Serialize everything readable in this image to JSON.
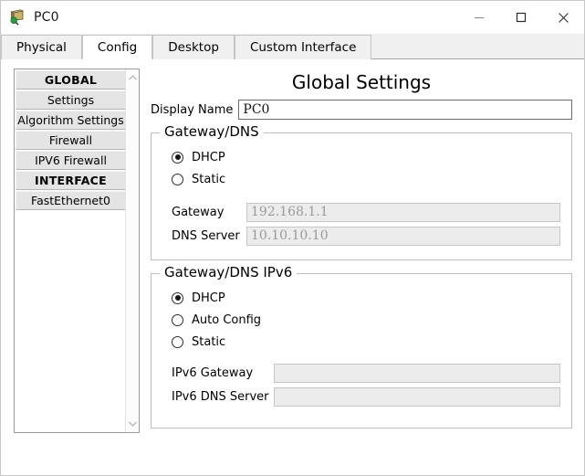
{
  "window": {
    "title": "PC0",
    "icon": "pc-device-icon",
    "controls": {
      "minimize": "minimize-icon",
      "maximize": "maximize-icon",
      "close": "close-icon"
    }
  },
  "tabs": [
    {
      "label": "Physical",
      "active": false
    },
    {
      "label": "Config",
      "active": true
    },
    {
      "label": "Desktop",
      "active": false
    },
    {
      "label": "Custom Interface",
      "active": false
    }
  ],
  "sidebar": {
    "items": [
      {
        "label": "GLOBAL",
        "type": "header"
      },
      {
        "label": "Settings",
        "type": "item"
      },
      {
        "label": "Algorithm Settings",
        "type": "item"
      },
      {
        "label": "Firewall",
        "type": "item"
      },
      {
        "label": "IPV6 Firewall",
        "type": "item"
      },
      {
        "label": "INTERFACE",
        "type": "header"
      },
      {
        "label": "FastEthernet0",
        "type": "item"
      }
    ],
    "scroll": {
      "up": "chevron-up-icon",
      "down": "chevron-down-icon"
    }
  },
  "main": {
    "title": "Global Settings",
    "display_name": {
      "label": "Display Name",
      "value": "PC0"
    },
    "gateway_dns": {
      "legend": "Gateway/DNS",
      "options": [
        {
          "label": "DHCP",
          "selected": true
        },
        {
          "label": "Static",
          "selected": false
        }
      ],
      "fields": [
        {
          "label": "Gateway",
          "value": "192.168.1.1",
          "disabled": true
        },
        {
          "label": "DNS Server",
          "value": "10.10.10.10",
          "disabled": true
        }
      ]
    },
    "gateway_dns_ipv6": {
      "legend": "Gateway/DNS IPv6",
      "options": [
        {
          "label": "DHCP",
          "selected": true
        },
        {
          "label": "Auto Config",
          "selected": false
        },
        {
          "label": "Static",
          "selected": false
        }
      ],
      "fields": [
        {
          "label": "IPv6 Gateway",
          "value": "",
          "disabled": true
        },
        {
          "label": "IPv6 DNS Server",
          "value": "",
          "disabled": true
        }
      ]
    }
  },
  "colors": {
    "window_bg": "#ffffff",
    "tab_bg": "#f0f0f0",
    "sidebar_item_bg": "#e4e4e4",
    "disabled_field_bg": "#ececec",
    "disabled_text": "#9a9a9a",
    "border": "#bdbdbd"
  }
}
